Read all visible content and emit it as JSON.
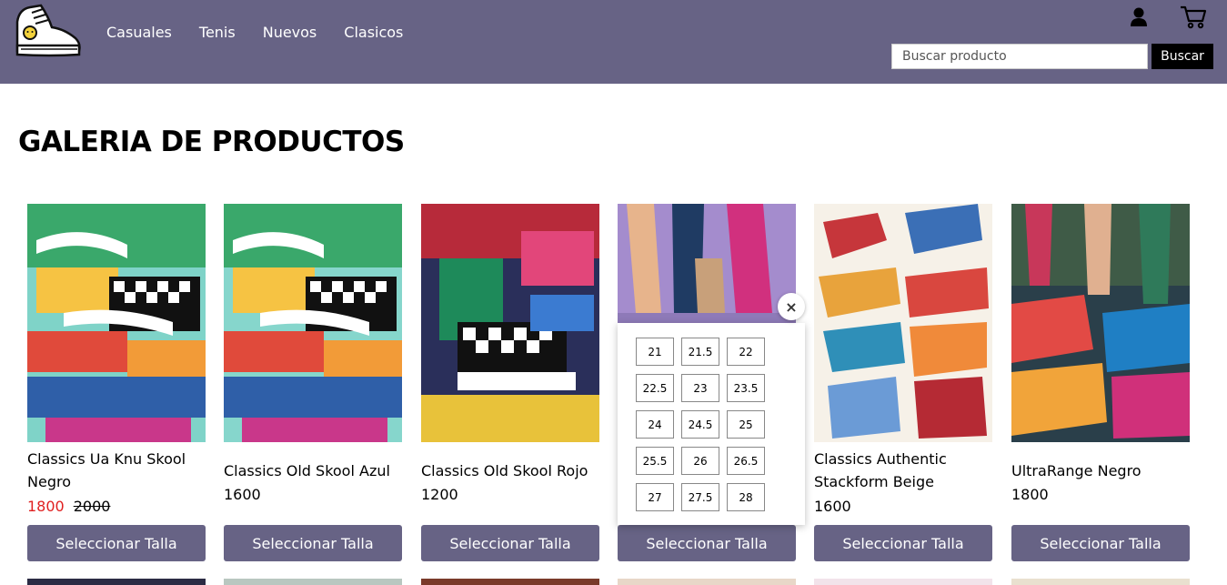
{
  "nav": [
    "Casuales",
    "Tenis",
    "Nuevos",
    "Clasicos"
  ],
  "search": {
    "placeholder": "Buscar producto",
    "button": "Buscar"
  },
  "page_title": "GALERIA DE PRODUCTOS",
  "products": [
    {
      "name": "Classics Ua Knu Skool Negro",
      "price": "1800",
      "old_price": "2000",
      "button": "Seleccionar Talla"
    },
    {
      "name": "Classics Old Skool Azul",
      "price": "1600",
      "button": "Seleccionar Talla"
    },
    {
      "name": "Classics Old Skool Rojo",
      "price": "1200",
      "button": "Seleccionar Talla"
    },
    {
      "name": "",
      "price": "",
      "button": "Seleccionar Talla"
    },
    {
      "name": "Classics Authentic Stackform Beige",
      "price": "1600",
      "button": "Seleccionar Talla"
    },
    {
      "name": "UltraRange Negro",
      "price": "1800",
      "button": "Seleccionar Talla"
    }
  ],
  "size_popup": {
    "close": "×",
    "sizes": [
      "21",
      "21.5",
      "22",
      "22.5",
      "23",
      "23.5",
      "24",
      "24.5",
      "25",
      "25.5",
      "26",
      "26.5",
      "27",
      "27.5",
      "28"
    ]
  },
  "colors": {
    "header": "#676385",
    "sale": "#e02020",
    "button": "#676385"
  },
  "icons": {
    "logo": "sneaker-logo-icon",
    "user": "user-icon",
    "cart": "cart-icon"
  }
}
